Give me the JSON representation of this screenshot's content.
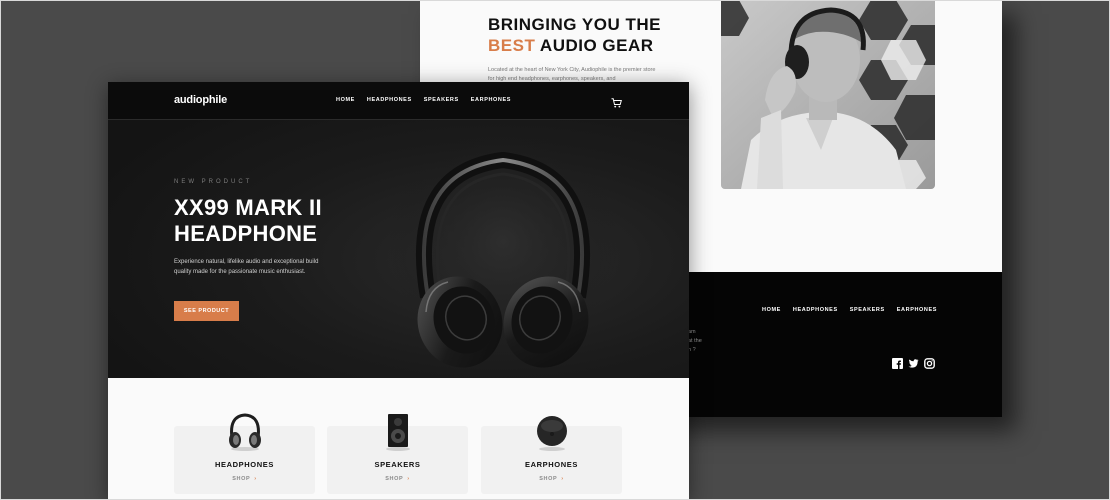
{
  "back_page": {
    "heading_line1": "BRINGING YOU THE",
    "heading_accent": "BEST",
    "heading_rest": " AUDIO GEAR",
    "body": "Located at the heart of New York City, Audiophile is the premier store for high end headphones, earphones, speakers, and",
    "footer_nav": [
      "HOME",
      "HEADPHONES",
      "SPEAKERS",
      "EARPHONES"
    ],
    "footer_text_fragment": "am\nat the\nn ?",
    "social_icons": [
      "facebook-icon",
      "twitter-icon",
      "instagram-icon"
    ]
  },
  "front_page": {
    "logo": "audiophile",
    "nav": [
      "HOME",
      "HEADPHONES",
      "SPEAKERS",
      "EARPHONES"
    ],
    "cart_icon": "cart-icon",
    "hero": {
      "overline": "NEW PRODUCT",
      "title_line1": "XX99 MARK II",
      "title_line2": "HEADPHONE",
      "description": "Experience natural, lifelike audio and exceptional build quality made for the passionate music enthusiast.",
      "cta": "SEE PRODUCT"
    },
    "categories": [
      {
        "title": "HEADPHONES",
        "shop": "SHOP"
      },
      {
        "title": "SPEAKERS",
        "shop": "SHOP"
      },
      {
        "title": "EARPHONES",
        "shop": "SHOP"
      }
    ]
  },
  "colors": {
    "accent": "#d87d4a",
    "dark": "#101010",
    "light": "#fafafa",
    "backdrop": "#4a4a4a"
  }
}
